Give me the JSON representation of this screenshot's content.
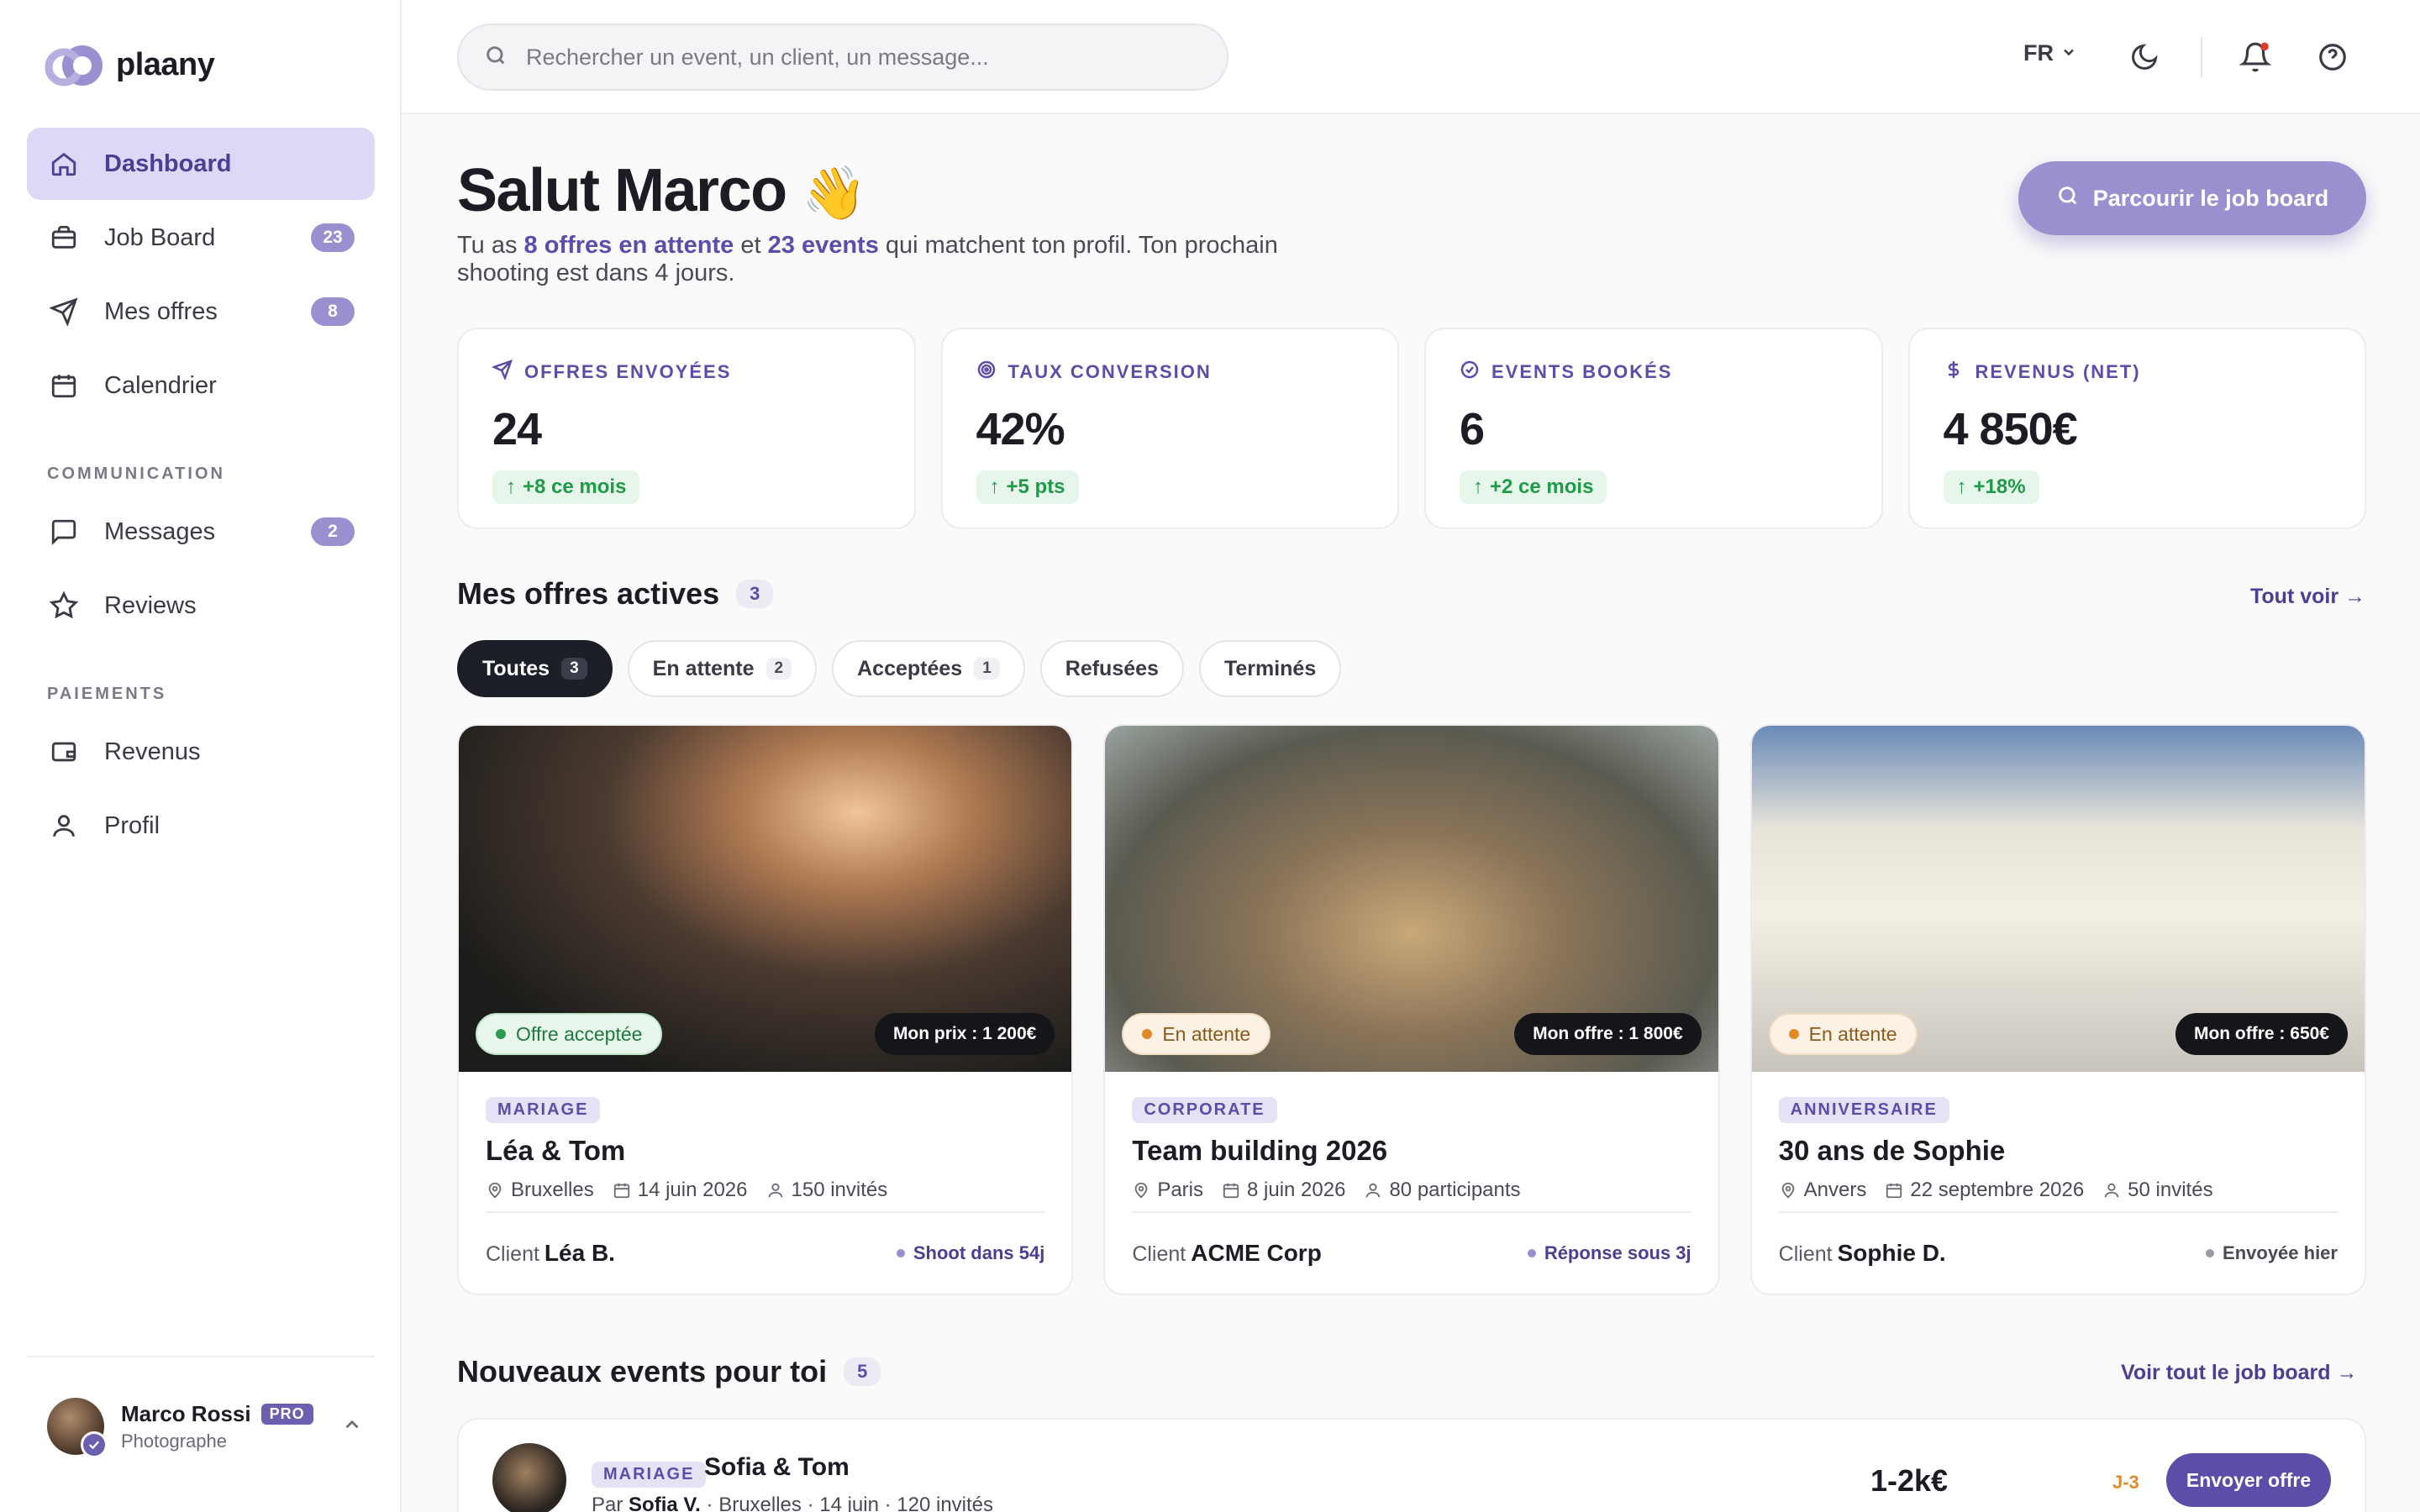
{
  "app": {
    "name": "plaany"
  },
  "sidebar": {
    "items": [
      {
        "label": "Dashboard",
        "badge": ""
      },
      {
        "label": "Job Board",
        "badge": "23"
      },
      {
        "label": "Mes offres",
        "badge": "8"
      },
      {
        "label": "Calendrier",
        "badge": ""
      }
    ],
    "section_communication": "COMMUNICATION",
    "comm_items": [
      {
        "label": "Messages",
        "badge": "2"
      },
      {
        "label": "Reviews",
        "badge": ""
      }
    ],
    "section_payments": "PAIEMENTS",
    "pay_items": [
      {
        "label": "Revenus"
      },
      {
        "label": "Profil"
      }
    ],
    "user": {
      "name": "Marco Rossi",
      "badge": "PRO",
      "role": "Photographe"
    }
  },
  "topbar": {
    "search_placeholder": "Rechercher un event, un client, un message...",
    "lang": "FR"
  },
  "greeting": {
    "title": "Salut Marco",
    "emoji": "👋",
    "sub_pre": "Tu as ",
    "sub_offers": "8 offres en attente",
    "sub_mid": " et ",
    "sub_events": "23 events",
    "sub_post": " qui matchent ton profil. Ton prochain shooting est dans 4 jours.",
    "cta": "Parcourir le job board"
  },
  "stats": [
    {
      "label": "OFFRES ENVOYÉES",
      "value": "24",
      "delta": "+8 ce mois"
    },
    {
      "label": "TAUX CONVERSION",
      "value": "42%",
      "delta": "+5 pts"
    },
    {
      "label": "EVENTS BOOKÉS",
      "value": "6",
      "delta": "+2 ce mois"
    },
    {
      "label": "REVENUS (NET)",
      "value": "4 850€",
      "delta": "+18%"
    }
  ],
  "active_offers": {
    "title": "Mes offres actives",
    "count": "3",
    "see_all": "Tout voir →",
    "filters": [
      {
        "label": "Toutes",
        "count": "3"
      },
      {
        "label": "En attente",
        "count": "2"
      },
      {
        "label": "Acceptées",
        "count": "1"
      },
      {
        "label": "Refusées",
        "count": ""
      },
      {
        "label": "Terminés",
        "count": ""
      }
    ],
    "cards": [
      {
        "status": "Offre acceptée",
        "price": "Mon prix : 1 200€",
        "tag": "MARIAGE",
        "title": "Léa & Tom",
        "city": "Bruxelles",
        "date": "14 juin 2026",
        "guests": "150 invités",
        "client_label": "Client",
        "client": "Léa B.",
        "note": "Shoot dans 54j"
      },
      {
        "status": "En attente",
        "price": "Mon offre : 1 800€",
        "tag": "CORPORATE",
        "title": "Team building 2026",
        "city": "Paris",
        "date": "8 juin 2026",
        "guests": "80 participants",
        "client_label": "Client",
        "client": "ACME Corp",
        "note": "Réponse sous 3j"
      },
      {
        "status": "En attente",
        "price": "Mon offre : 650€",
        "tag": "ANNIVERSAIRE",
        "title": "30 ans de Sophie",
        "city": "Anvers",
        "date": "22 septembre 2026",
        "guests": "50 invités",
        "client_label": "Client",
        "client": "Sophie D.",
        "note": "Envoyée hier"
      }
    ]
  },
  "new_events": {
    "title": "Nouveaux events pour toi",
    "count": "5",
    "see_all": "Voir tout le job board →",
    "item": {
      "tag": "MARIAGE",
      "title": "Sofia & Tom",
      "by_label": "Par",
      "by": "Sofia V.",
      "meta": " · Bruxelles · 14 juin · 120 invités",
      "price": "1-2k€",
      "deadline": "J-3",
      "action": "Envoyer offre"
    }
  },
  "colors": {
    "accent": "#5b4ea8",
    "accent_soft": "#ddd8f6",
    "success": "#1e9a48",
    "warning": "#e08a2a"
  }
}
